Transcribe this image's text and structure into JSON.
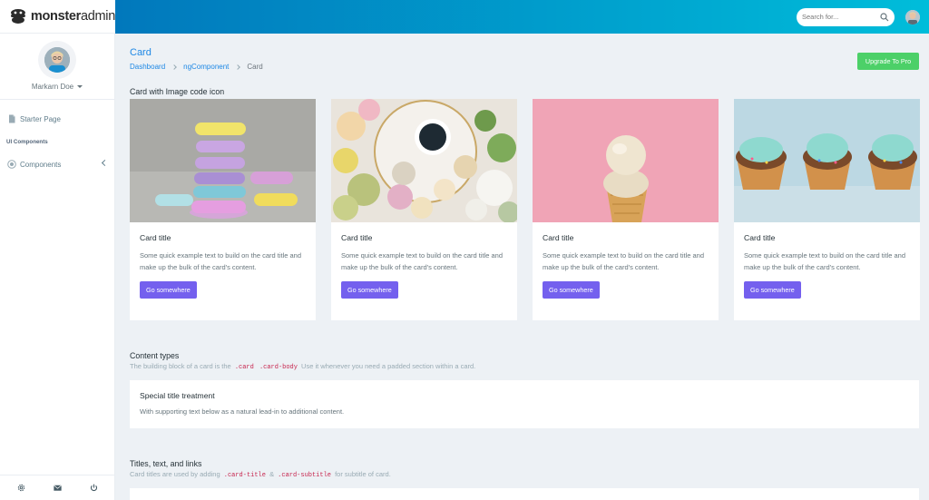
{
  "brand": {
    "bold": "monster",
    "light": "admin"
  },
  "search": {
    "placeholder": "Search for..."
  },
  "profile": {
    "name": "Markarn Doe"
  },
  "sidebar": {
    "items": [
      {
        "label": "Starter Page",
        "icon": "file-icon"
      },
      {
        "label": "UI Components",
        "type": "section-label"
      },
      {
        "label": "Components",
        "icon": "gear-circle-icon"
      }
    ],
    "footer_icons": [
      "settings-icon",
      "mail-icon",
      "power-icon"
    ]
  },
  "page": {
    "title": "Card",
    "breadcrumb": [
      "Dashboard",
      "ngComponent",
      "Card"
    ],
    "upgrade_label": "Upgrade To Pro"
  },
  "sections": {
    "cards_title": "Card with Image code icon",
    "content_types_title": "Content types",
    "content_types_sub_pre": "The building block of a card is the",
    "content_types_code1": ".card",
    "content_types_code2": ".card-body",
    "content_types_sub_post": "Use it whenever you need a padded section within a card.",
    "special_title": "Special title treatment",
    "special_text": "With supporting text below as a natural lead-in to additional content.",
    "titles_title": "Titles, text, and links",
    "titles_sub_pre": "Card titles are used by adding",
    "titles_code1": ".card-title",
    "titles_amp": "&",
    "titles_code2": ".card-subtitle",
    "titles_sub_post": "for subtitle of card."
  },
  "cards": [
    {
      "title": "Card title",
      "text": "Some quick example text to build on the card title and make up the bulk of the card's content.",
      "button": "Go somewhere",
      "image": "macarons-stack"
    },
    {
      "title": "Card title",
      "text": "Some quick example text to build on the card title and make up the bulk of the card's content.",
      "button": "Go somewhere",
      "image": "macarons-coffee"
    },
    {
      "title": "Card title",
      "text": "Some quick example text to build on the card title and make up the bulk of the card's content.",
      "button": "Go somewhere",
      "image": "ice-cream-cone"
    },
    {
      "title": "Card title",
      "text": "Some quick example text to build on the card title and make up the bulk of the card's content.",
      "button": "Go somewhere",
      "image": "cupcakes"
    }
  ],
  "colors": {
    "topbar_start": "#0178bc",
    "topbar_end": "#00bdda",
    "primary_link": "#1e88e5",
    "button_purple": "#7460ee",
    "button_green": "#4cd068"
  }
}
